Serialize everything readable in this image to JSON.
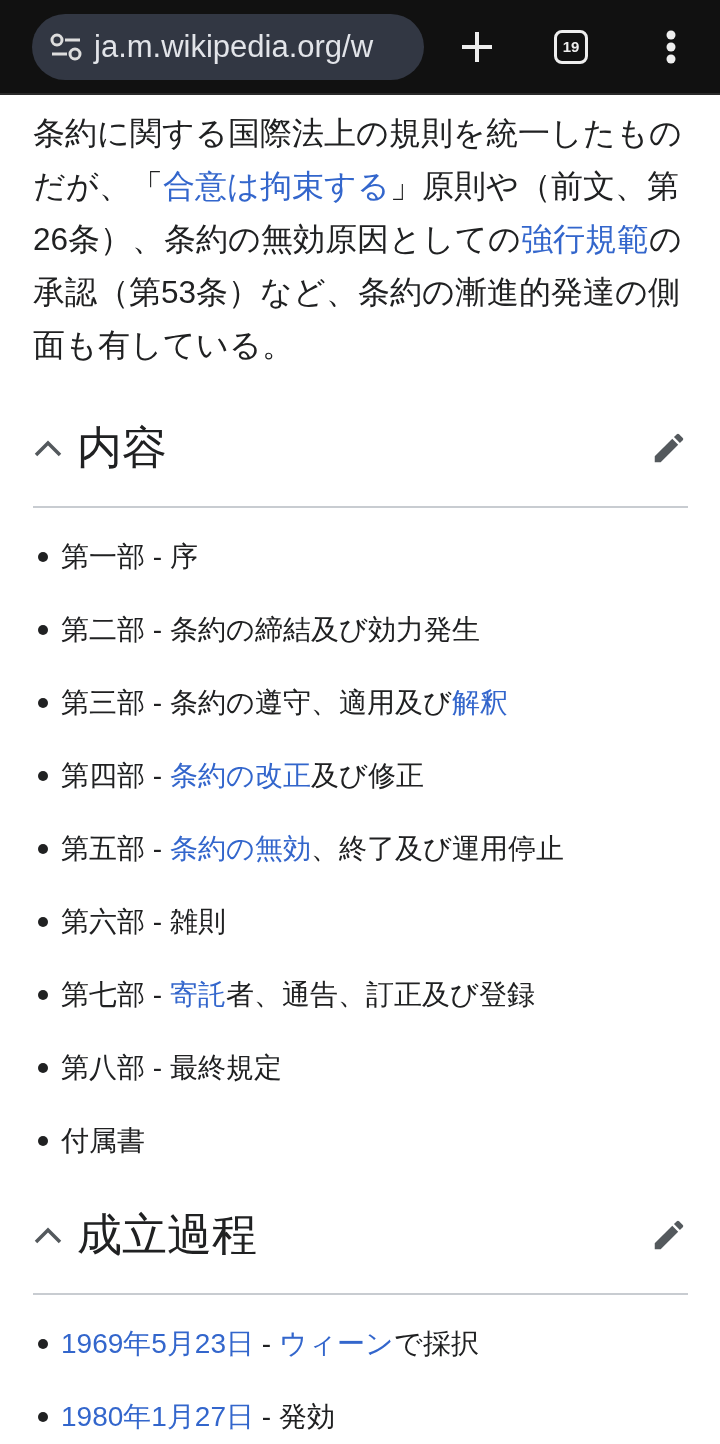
{
  "browser": {
    "url": "ja.m.wikipedia.org/w",
    "tab_count": "19"
  },
  "intro": [
    {
      "text": "条約に関する国際法上の規則を統一したものだが、「",
      "link": false
    },
    {
      "text": "合意は拘束する",
      "link": true
    },
    {
      "text": "」原則や（前文、第26条）、条約の無効原因としての",
      "link": false
    },
    {
      "text": "強行規範",
      "link": true
    },
    {
      "text": "の承認（第53条）など、条約の漸進的発達の側面も有している。",
      "link": false
    }
  ],
  "sections": [
    {
      "title": "内容",
      "expanded": true,
      "items": [
        [
          {
            "text": "第一部 - 序",
            "link": false
          }
        ],
        [
          {
            "text": "第二部 - 条約の締結及び効力発生",
            "link": false
          }
        ],
        [
          {
            "text": "第三部 - 条約の遵守、適用及び",
            "link": false
          },
          {
            "text": "解釈",
            "link": true
          }
        ],
        [
          {
            "text": "第四部 - ",
            "link": false
          },
          {
            "text": "条約の改正",
            "link": true
          },
          {
            "text": "及び修正",
            "link": false
          }
        ],
        [
          {
            "text": "第五部 - ",
            "link": false
          },
          {
            "text": "条約の無効",
            "link": true
          },
          {
            "text": "、終了及び運用停止",
            "link": false
          }
        ],
        [
          {
            "text": "第六部 - 雑則",
            "link": false
          }
        ],
        [
          {
            "text": "第七部 - ",
            "link": false
          },
          {
            "text": "寄託",
            "link": true
          },
          {
            "text": "者、通告、訂正及び登録",
            "link": false
          }
        ],
        [
          {
            "text": "第八部 - 最終規定",
            "link": false
          }
        ],
        [
          {
            "text": "付属書",
            "link": false
          }
        ]
      ]
    },
    {
      "title": "成立過程",
      "expanded": true,
      "items": [
        [
          {
            "text": "1969年5月23日",
            "link": true
          },
          {
            "text": " - ",
            "link": false
          },
          {
            "text": "ウィーン",
            "link": true
          },
          {
            "text": "で採択",
            "link": false
          }
        ],
        [
          {
            "text": "1980年1月27日",
            "link": true
          },
          {
            "text": " - 発効",
            "link": false
          }
        ]
      ]
    }
  ]
}
